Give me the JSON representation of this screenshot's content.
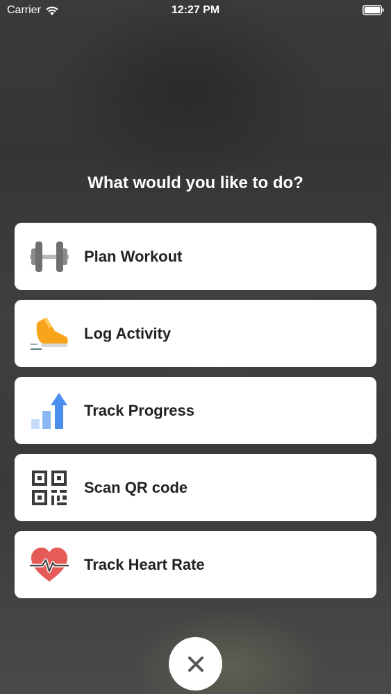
{
  "status_bar": {
    "carrier": "Carrier",
    "time": "12:27 PM",
    "wifi_icon": "wifi-icon",
    "battery_icon": "battery-icon"
  },
  "prompt": "What would you like to do?",
  "menu": {
    "items": [
      {
        "label": "Plan Workout",
        "icon": "dumbbell-icon"
      },
      {
        "label": "Log Activity",
        "icon": "running-shoe-icon"
      },
      {
        "label": "Track Progress",
        "icon": "bar-chart-arrow-icon"
      },
      {
        "label": "Scan QR code",
        "icon": "qr-code-icon"
      },
      {
        "label": "Track Heart Rate",
        "icon": "heart-rate-icon"
      }
    ]
  },
  "close_button": {
    "icon": "close-icon"
  },
  "colors": {
    "card_background": "#ffffff",
    "label_text": "#222222",
    "shoe_orange": "#f7a41a",
    "chart_blue": "#4a8ff0",
    "heart_red": "#e55b57",
    "dumbbell_gray": "#7c7c7c"
  }
}
